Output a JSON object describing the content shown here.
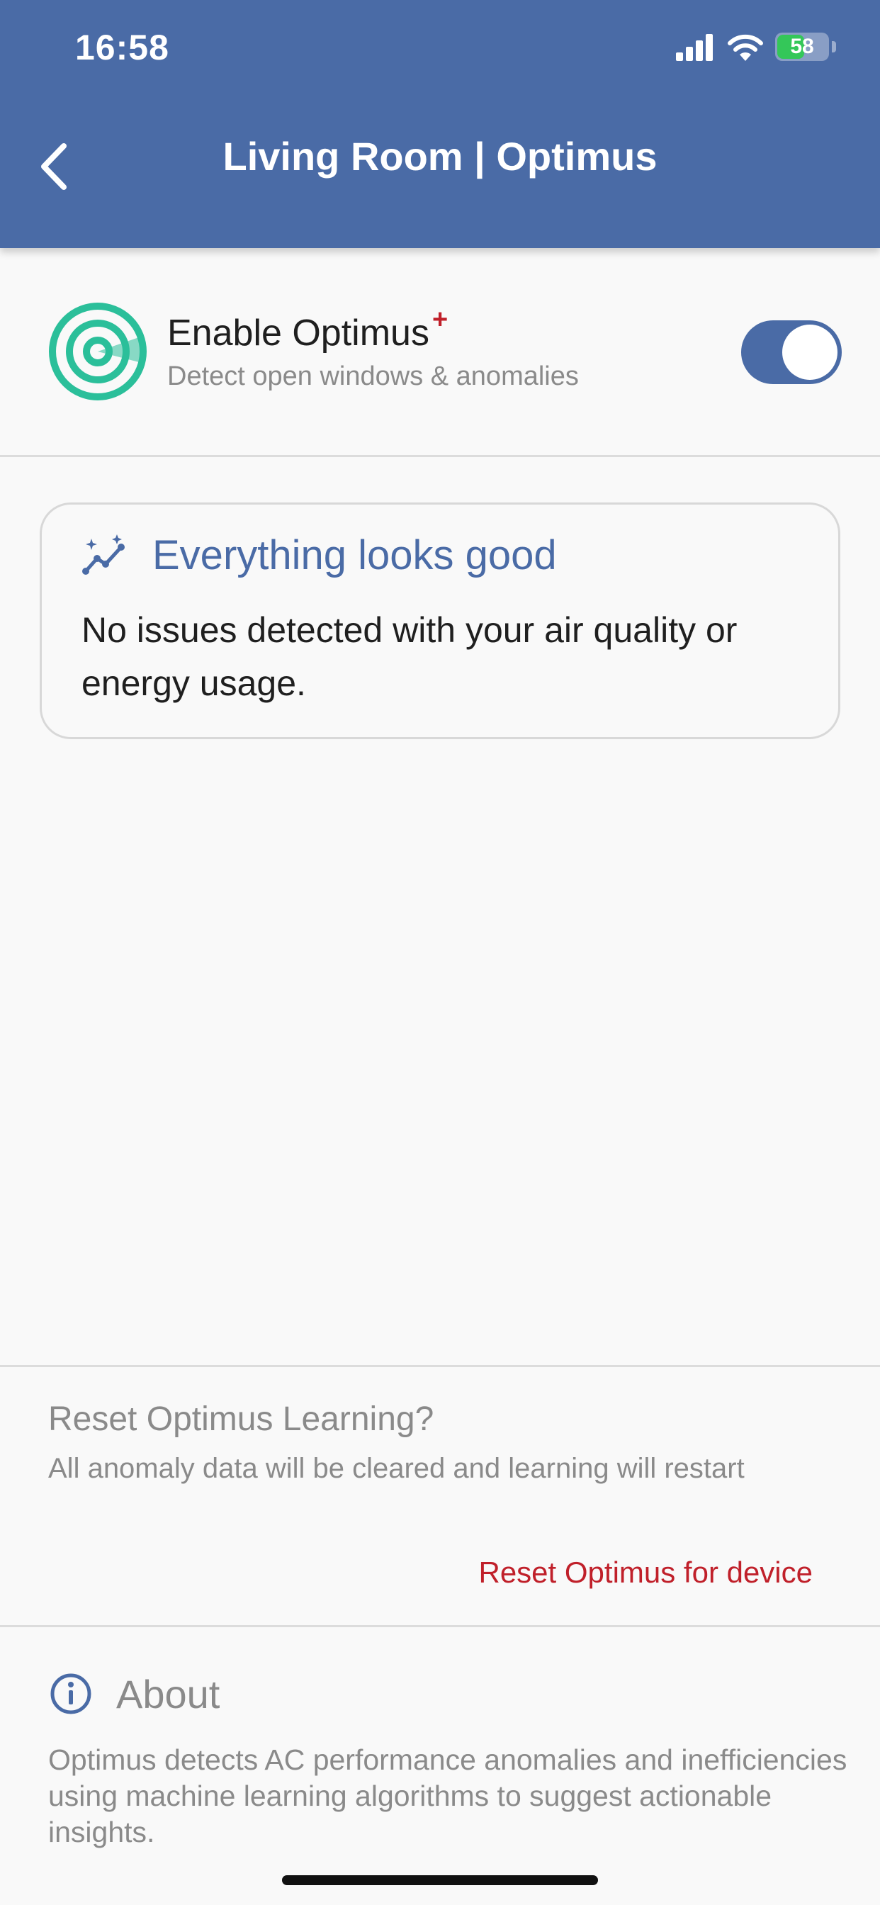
{
  "status_bar": {
    "time": "16:58",
    "battery_percent": "58",
    "battery_level": 0.58,
    "icons": [
      "signal-icon",
      "wifi-icon",
      "battery-charging-icon"
    ]
  },
  "header": {
    "title": "Living Room | Optimus",
    "back_icon": "chevron-left-icon",
    "background_color": "#4a6ba6"
  },
  "enable": {
    "title": "Enable Optimus",
    "plus_mark": "+",
    "subtitle": "Detect open windows & anomalies",
    "icon": "radar-icon",
    "toggle_on": true,
    "accent_color": "#2bbf9a"
  },
  "status_card": {
    "icon": "sparkle-trend-icon",
    "title": "Everything looks good",
    "message": "No issues detected with your air quality or energy usage."
  },
  "reset": {
    "title": "Reset Optimus Learning?",
    "description": "All anomaly data will be cleared and learning will restart",
    "action_label": "Reset Optimus for device",
    "action_color": "#c0202a"
  },
  "about": {
    "icon": "info-icon",
    "title": "About",
    "text": "Optimus detects AC performance anomalies and inefficiencies using machine learning algorithms to suggest actionable insights."
  }
}
